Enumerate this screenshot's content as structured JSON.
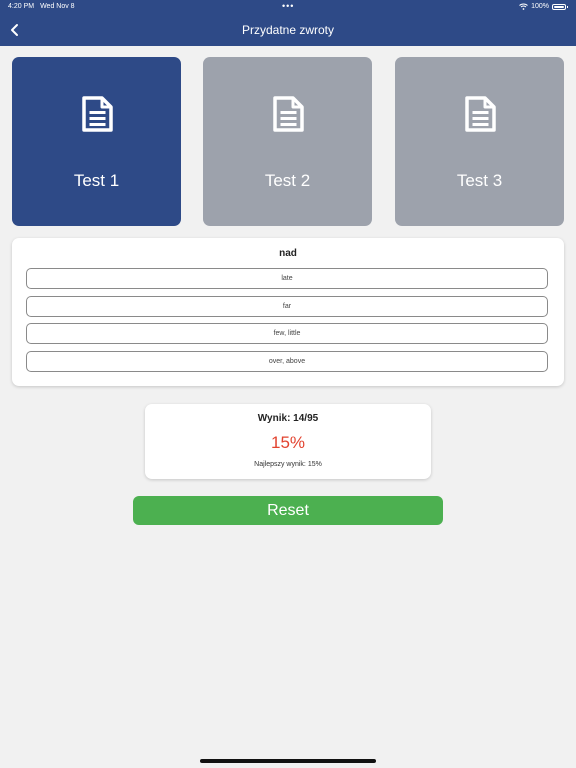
{
  "status_bar": {
    "time": "4:20 PM",
    "date": "Wed Nov 8",
    "dots": "•••",
    "battery": "100%",
    "icons": [
      "wifi-icon",
      "battery-icon"
    ]
  },
  "header": {
    "title": "Przydatne zwroty",
    "back_icon": "chevron-left-icon"
  },
  "tests": [
    {
      "label": "Test 1",
      "selected": true,
      "icon": "document-icon"
    },
    {
      "label": "Test 2",
      "selected": false,
      "icon": "document-icon"
    },
    {
      "label": "Test 3",
      "selected": false,
      "icon": "document-icon"
    }
  ],
  "question": {
    "word": "nad",
    "options": [
      "late",
      "far",
      "few, little",
      "over, above"
    ]
  },
  "score": {
    "label": "Wynik: 14/95",
    "percent": "15%",
    "best": "Najlepszy wynik: 15%"
  },
  "reset_label": "Reset",
  "colors": {
    "primary": "#2e4a87",
    "inactive_card": "#9da2ac",
    "score": "#e2432f",
    "reset": "#4cb050",
    "background": "#f1f1f1"
  }
}
